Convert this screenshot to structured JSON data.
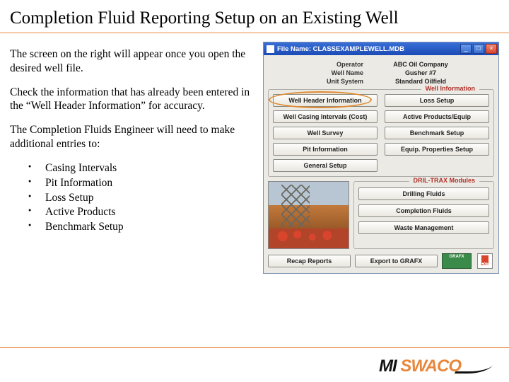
{
  "title": "Completion Fluid Reporting Setup on an Existing Well",
  "body": {
    "p1": "The screen on the right will appear once you open the desired well file.",
    "p2": "Check the information that has already been entered in the “Well Header Information” for accuracy.",
    "p3": "The Completion Fluids Engineer will need to make additional entries to:",
    "bullets": [
      "Casing Intervals",
      "Pit Information",
      "Loss Setup",
      "Active Products",
      "Benchmark Setup"
    ]
  },
  "app": {
    "titlebar": "File Name: CLASSEXAMPLEWELL.MDB",
    "info": {
      "operator_label": "Operator",
      "operator_value": "ABC Oil Company",
      "wellname_label": "Well Name",
      "wellname_value": "Gusher #7",
      "unitsys_label": "Unit System",
      "unitsys_value": "Standard Oilfield"
    },
    "well_info_legend": "Well Information",
    "well_buttons": {
      "header_info": "Well Header Information",
      "loss_setup": "Loss Setup",
      "casing": "Well Casing Intervals (Cost)",
      "active_products": "Active Products/Equip",
      "survey": "Well Survey",
      "benchmark": "Benchmark Setup",
      "pit": "Pit Information",
      "equip_props": "Equip. Properties Setup",
      "general": "General Setup"
    },
    "modules_legend": "DRIL-TRAX Modules",
    "module_buttons": {
      "drilling": "Drilling Fluids",
      "completion": "Completion Fluids",
      "waste": "Waste Management"
    },
    "bottom": {
      "recap": "Recap Reports",
      "export_grafx": "Export to GRAFX",
      "grafx_badge": "GRAFX",
      "exit": "EXIT"
    }
  },
  "logo": {
    "part1": "M",
    "part2": "I",
    "part3": "SWACO"
  }
}
